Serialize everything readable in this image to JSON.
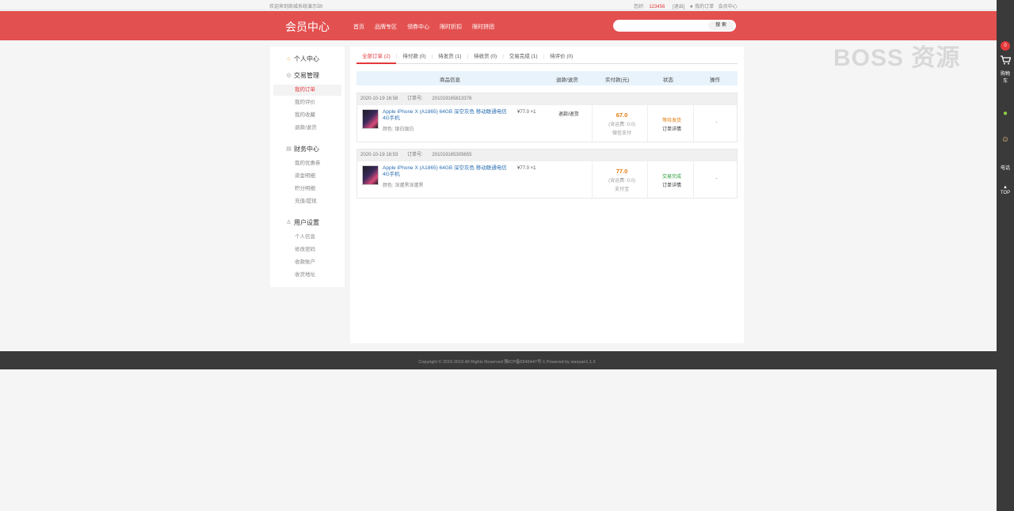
{
  "topbar": {
    "welcome": "欢迎来到商城系统演示站!",
    "greeting": "您好: ",
    "user_id": "123456",
    "logout": "[退出]",
    "my_orders": "★ 我的订单",
    "member_center": "会员中心"
  },
  "header": {
    "title": "会员中心",
    "nav": [
      "首页",
      "品牌专区",
      "领券中心",
      "限时折扣",
      "限时拼团"
    ],
    "search_placeholder": "",
    "search_button": "搜 索"
  },
  "sidebar": {
    "groups": [
      {
        "title": "个人中心",
        "icon": "home-icon",
        "items": []
      },
      {
        "title": "交易管理",
        "icon": "trade-icon",
        "items": [
          "我的订单",
          "我的评价",
          "我的收藏",
          "退款/退货"
        ]
      },
      {
        "title": "财务中心",
        "icon": "finance-icon",
        "items": [
          "我的优惠券",
          "资金明细",
          "积分明细",
          "充值/提现"
        ]
      },
      {
        "title": "用户设置",
        "icon": "user-icon",
        "items": [
          "个人信息",
          "修改密码",
          "收款账户",
          "收货地址"
        ]
      }
    ],
    "active_item": "我的订单"
  },
  "tabs": [
    {
      "label": "全部订单 (2)",
      "active": true
    },
    {
      "label": "待付款 (0)",
      "active": false
    },
    {
      "label": "待发货 (1)",
      "active": false
    },
    {
      "label": "待收货 (0)",
      "active": false
    },
    {
      "label": "交易完成 (1)",
      "active": false
    },
    {
      "label": "待评价 (0)",
      "active": false
    }
  ],
  "table_headers": [
    "商品信息",
    "退款/退货",
    "实付款(元)",
    "状态",
    "操作"
  ],
  "orders": [
    {
      "date": "2020-10-19 16:58",
      "order_no_label": "订单号:",
      "order_no": "201019165813376",
      "product_name": "Apple iPhone X (A1865) 64GB 深空灰色 移动联通电信4G手机",
      "color": "颜色: 银白银白",
      "price": "¥77.0 ×1",
      "refund": "退款/退货",
      "amount": "67.0",
      "fee": "(含运费: 0.0)",
      "pay_method": "微信支付",
      "status": "等待发货",
      "status_color": "#e4790c",
      "detail": "订单详情",
      "ops": "-"
    },
    {
      "date": "2020-10-19 16:53",
      "order_no_label": "订单号:",
      "order_no": "201019165305655",
      "product_name": "Apple iPhone X (A1865) 64GB 深空灰色 移动联通电信4G手机",
      "color": "颜色: 深邃黑深邃黑",
      "price": "¥77.0 ×1",
      "refund": "",
      "amount": "77.0",
      "fee": "(含运费: 0.0)",
      "pay_method": "支付宝",
      "status": "交易完成",
      "status_color": "#2e9d3a",
      "detail": "订单详情",
      "ops": "-"
    }
  ],
  "footer": {
    "copyright": "Copyright © 2015-2019 All Rights Reserved 豫ICP备6545447号-1    Powered by xiaoyan1.1.3"
  },
  "watermark": "BOSS 资源",
  "right_toolbar": {
    "cart_count": "0",
    "cart_label": "购物车",
    "phone_label": "电话",
    "top_label": "TOP"
  }
}
